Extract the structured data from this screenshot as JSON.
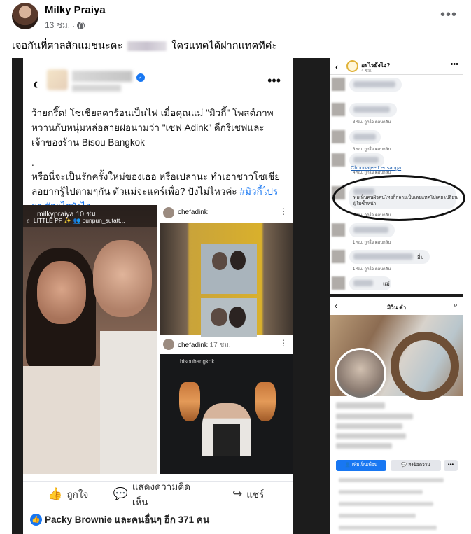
{
  "post": {
    "author": "Milky Praiya",
    "time": "13 ชม.",
    "caption_before": "เจอกันที่ศาลสักแมชนะคะ",
    "caption_after": "ใครแทคได้ฝากแทคทีค่ะ",
    "more": "•••"
  },
  "left_screenshot": {
    "back": "‹",
    "more": "•••",
    "text_p1": "ว้ายกรี๊ด! โซเชียลดาร้อนเป็นไฟ เมื่อคุณแม่ \"มิวกี้\" โพสต์ภาพหวานกับหนุ่มหล่อสายฝอนามว่า \"เชฟ Adink\" ดีกรีเชฟและเจ้าของร้าน Bisou Bangkok",
    "text_dot": ".",
    "text_p2": "หรือนี่จะเป็นรักครั้งใหม่ของเธอ หรือเปล่านะ ทำเอาชาวโซเชียลอยากรู้ไปตามๆกัน ตัวแม่จะแคร์เพื่อ? ปังไม่ไหวค่ะ",
    "hashtag1": "#มิวกี้ไปรยา",
    "hashtag2": "#อะไรยังไง",
    "ig_main_name": "milkypraiya",
    "ig_main_time": "10 ชม.",
    "ig_main_sub": "♬ LITTLE PP ✨  👥 punpun_sutatt...",
    "chef1_name": "chefadink",
    "chef2_name": "chefadink",
    "chef2_time": "17 ชม.",
    "chef2_label": "bisoubangkok",
    "like_label": "ถูกใจ",
    "comment_label": "แสดงความคิดเห็น",
    "share_label": "แชร์",
    "reactions": "Packy Brownie และคนอื่นๆ อีก 371 คน"
  },
  "right_top": {
    "back": "‹",
    "page_title": "อะไรยังไง?",
    "page_sub": "4 ชม.",
    "more": "•••",
    "meta_3": "3 ชม.   ถูกใจ   ตอบกลับ",
    "meta_1": "1 ชม.   ถูกใจ   ตอบกลับ",
    "meta_2": "2 ชม.   ถูกใจ   ตอบกลับ",
    "meta_4": "4 ชม.   ถูกใจ   ตอบกลับ",
    "mention": "Chonnatee Lertsanga",
    "circled_comment": "พอเห็นคนผิวคนไทยก็กลายเป็นเลยแทคไปเคย เปลี่ยนผู้ไม่ซ้ำหน้า",
    "word_1": "อื่ม",
    "word_2": "แม่"
  },
  "right_bottom": {
    "back": "‹",
    "title": "มิวิน ค่ำ",
    "search": "⌕",
    "add_friend": "👤 เพิ่มเป็นเพื่อน",
    "message": "💬 ส่งข้อความ",
    "more": "•••"
  },
  "colors": {
    "fb_blue": "#1877f2",
    "secondary_text": "#65676b",
    "dark_background": "#1c1c1c"
  }
}
